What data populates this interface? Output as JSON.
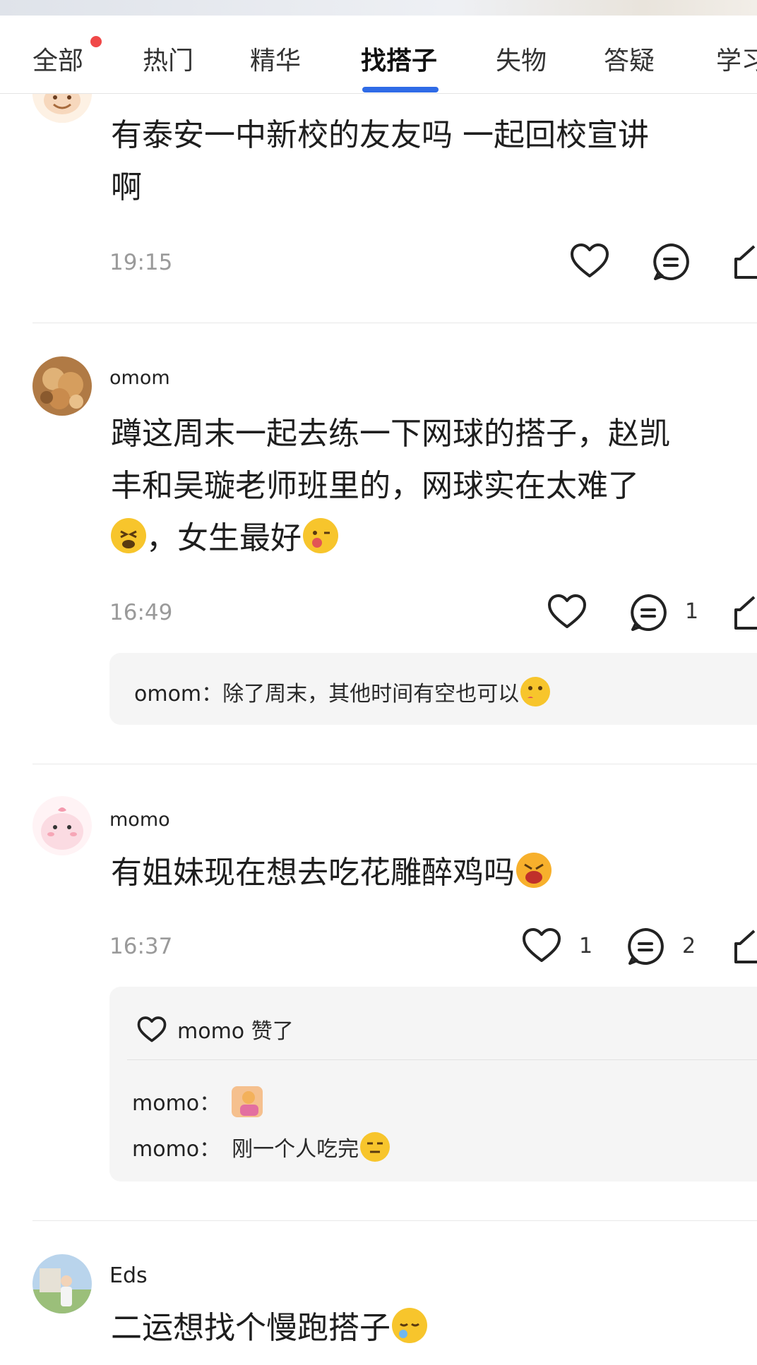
{
  "tabs": [
    {
      "label": "全部",
      "has_dot": true
    },
    {
      "label": "热门"
    },
    {
      "label": "精华"
    },
    {
      "label": "找搭子",
      "active": true
    },
    {
      "label": "失物"
    },
    {
      "label": "答疑"
    },
    {
      "label": "学习"
    }
  ],
  "posts": [
    {
      "username": "",
      "lines": [
        "有泰安一中新校的友友吗  一起回校宣讲",
        "啊"
      ],
      "time": "19:15",
      "likes": "",
      "comments": ""
    },
    {
      "username": "omom",
      "lines": [
        "蹲这周末一起去练一下网球的搭子，赵凯",
        "丰和吴璇老师班里的，网球实在太难了"
      ],
      "line3": "，女生最好",
      "time": "16:49",
      "likes": "",
      "comments": "1",
      "replies": [
        {
          "name": "omom",
          "sep": "：",
          "text": "除了周末，其他时间有空也可以"
        }
      ]
    },
    {
      "username": "momo",
      "lines": [
        "有姐妹现在想去吃花雕醉鸡吗"
      ],
      "time": "16:37",
      "likes": "1",
      "comments": "2",
      "like_notice": {
        "name": "momo",
        "text": "赞了"
      },
      "replies": [
        {
          "name": "momo",
          "sep": "：",
          "text": ""
        },
        {
          "name": "momo",
          "sep": "：",
          "text": "刚一个人吃完"
        }
      ]
    },
    {
      "username": "Eds",
      "lines": [
        "二运想找个慢跑搭子"
      ]
    }
  ],
  "colors": {
    "accent": "#2f6be6",
    "dot": "#f04848",
    "reply_bg": "#f5f5f5",
    "time": "#9a9a9a"
  },
  "icons": [
    "heart-icon",
    "comment-icon",
    "share-icon"
  ]
}
